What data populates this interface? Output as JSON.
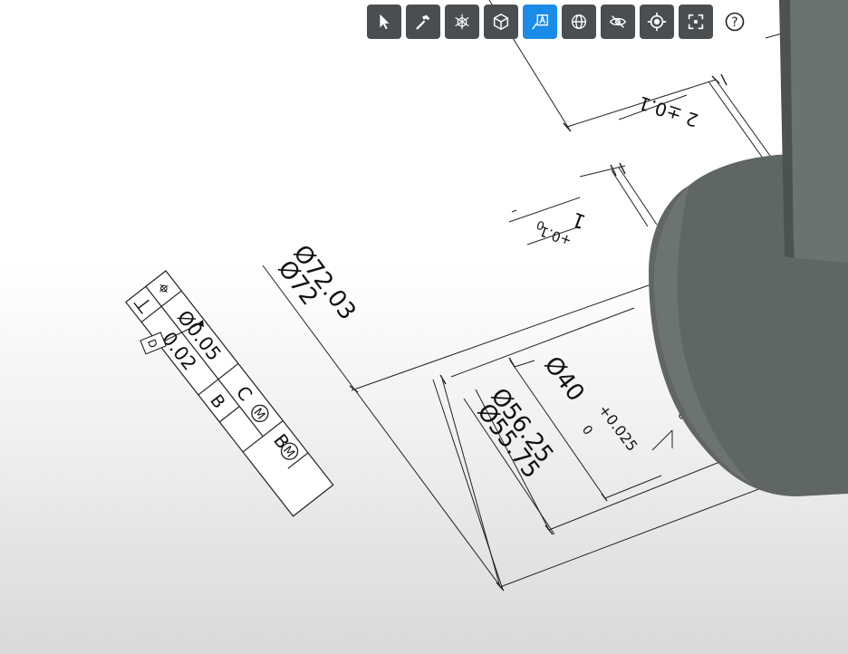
{
  "toolbar": {
    "buttons": [
      {
        "name": "select-tool",
        "icon": "cursor-arrow-icon",
        "active": false
      },
      {
        "name": "measure-tool",
        "icon": "hammer-icon",
        "active": false
      },
      {
        "name": "axis-tool",
        "icon": "axis-cube-icon",
        "active": false
      },
      {
        "name": "view-cube-tool",
        "icon": "cube-icon",
        "active": false
      },
      {
        "name": "annotation-tool",
        "icon": "annotation-a-icon",
        "active": true
      },
      {
        "name": "globe-tool",
        "icon": "globe-icon",
        "active": false
      },
      {
        "name": "hide-tool",
        "icon": "eye-slash-icon",
        "active": false
      },
      {
        "name": "target-tool",
        "icon": "crosshair-icon",
        "active": false
      },
      {
        "name": "fit-tool",
        "icon": "fit-frame-icon",
        "active": false
      }
    ],
    "help_icon": "question-circle-icon",
    "accent_color": "#1a8ce8",
    "button_color": "#4b4e50"
  },
  "drawing": {
    "fcf": {
      "row1_symbol": "⌖",
      "row1_tolerance": "Ø0.05",
      "row1_datum1": "C",
      "row1_datum2": "B",
      "row1_modifier": "M",
      "row2_symbol": "⊥",
      "row2_tolerance": "0.02",
      "row2_datum": "B",
      "datum_feature": "D"
    },
    "dims": {
      "outer_upper": "Ø72.03",
      "outer_lower": "Ø72",
      "mid_upper": "Ø56.25",
      "mid_lower": "Ø55.75",
      "bore": "Ø40",
      "bore_tol_upper": "+0.025",
      "bore_tol_lower": "0",
      "step_1": "1",
      "step_1_tol_upper": "+0.1",
      "step_1_tol_lower": "0",
      "step_2": "2 ±0.1",
      "small_note": "0.0"
    },
    "part_color": "#5f6663"
  }
}
